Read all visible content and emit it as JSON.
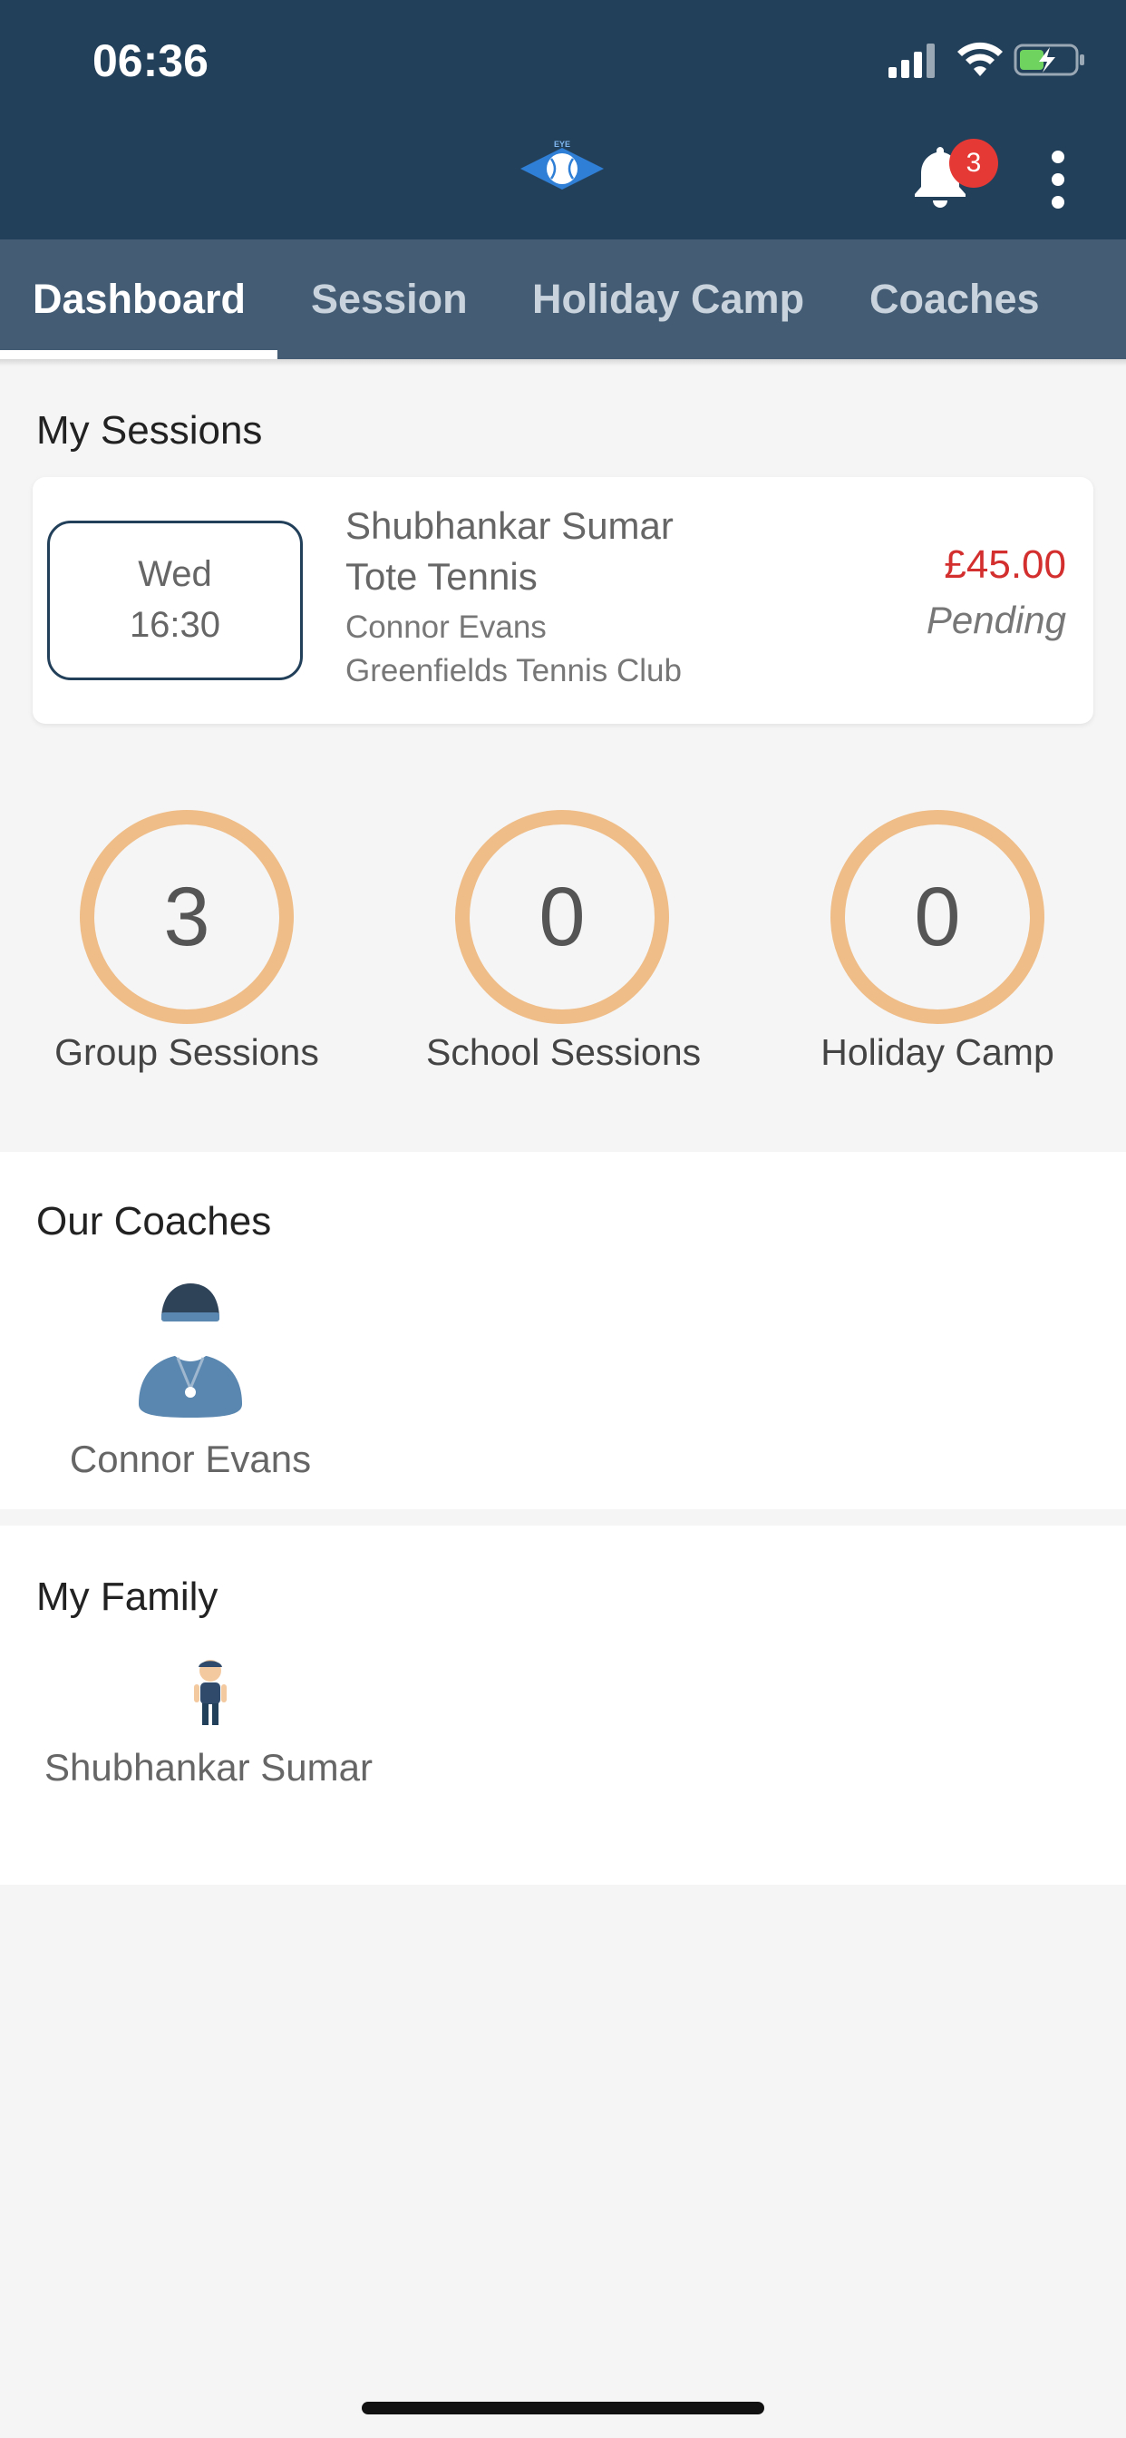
{
  "status_bar": {
    "time": "06:36"
  },
  "header": {
    "logo_text": "EYE",
    "notifications": {
      "count": "3",
      "icon": "bell-icon"
    },
    "menu_icon": "more-vertical-icon",
    "colors": {
      "header_bg": "#23405a",
      "tabbar_bg": "#445d74",
      "badge": "#e53935"
    }
  },
  "tabs": [
    {
      "label": "Dashboard",
      "active": true
    },
    {
      "label": "Session",
      "active": false
    },
    {
      "label": "Holiday Camp",
      "active": false
    },
    {
      "label": "Coaches",
      "active": false
    }
  ],
  "my_sessions": {
    "title": "My Sessions",
    "items": [
      {
        "day": "Wed",
        "time": "16:30",
        "student": "Shubhankar Sumar",
        "course": "Tote Tennis",
        "coach": "Connor Evans",
        "venue": "Greenfields Tennis Club",
        "price": "£45.00",
        "status": "Pending"
      }
    ]
  },
  "stats": [
    {
      "value": "3",
      "label": "Group Sessions"
    },
    {
      "value": "0",
      "label": "School Sessions"
    },
    {
      "value": "0",
      "label": "Holiday Camp"
    }
  ],
  "our_coaches": {
    "title": "Our Coaches",
    "items": [
      {
        "name": "Connor Evans",
        "icon": "coach-avatar-icon"
      }
    ]
  },
  "my_family": {
    "title": "My Family",
    "items": [
      {
        "name": "Shubhankar Sumar",
        "icon": "child-avatar-icon"
      }
    ]
  }
}
